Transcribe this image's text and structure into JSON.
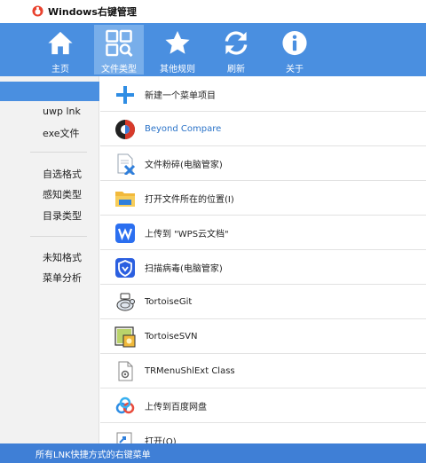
{
  "window": {
    "title": "Windows右键管理"
  },
  "toolbar": {
    "items": [
      {
        "label": "主页",
        "icon": "home-icon"
      },
      {
        "label": "文件类型",
        "icon": "file-types-icon",
        "active": true
      },
      {
        "label": "其他规则",
        "icon": "star-icon"
      },
      {
        "label": "刷新",
        "icon": "refresh-icon"
      },
      {
        "label": "关于",
        "icon": "info-icon"
      }
    ],
    "accent": "#4a8fe0"
  },
  "sidebar": {
    "items": [
      {
        "label": ""
      },
      {
        "label": "uwp lnk"
      },
      {
        "label": "exe文件"
      },
      {
        "label": "自选格式"
      },
      {
        "label": "感知类型"
      },
      {
        "label": "目录类型"
      },
      {
        "label": "未知格式"
      },
      {
        "label": "菜单分析"
      }
    ]
  },
  "menu_items": [
    {
      "label": "新建一个菜单项目",
      "icon": "plus-icon"
    },
    {
      "label": "Beyond Compare",
      "icon": "beyond-compare-icon",
      "highlight": true
    },
    {
      "label": "文件粉碎(电脑管家)",
      "icon": "file-shred-icon"
    },
    {
      "label": "打开文件所在的位置(I)",
      "icon": "folder-icon"
    },
    {
      "label": "上传到 \"WPS云文档\"",
      "icon": "wps-icon"
    },
    {
      "label": "扫描病毒(电脑管家)",
      "icon": "shield-icon"
    },
    {
      "label": "TortoiseGit",
      "icon": "tortoisegit-icon"
    },
    {
      "label": "TortoiseSVN",
      "icon": "tortoisesvn-icon"
    },
    {
      "label": "TRMenuShlExt Class",
      "icon": "document-gear-icon"
    },
    {
      "label": "上传到百度网盘",
      "icon": "baidu-cloud-icon"
    },
    {
      "label": "打开(O)",
      "icon": "shortcut-icon"
    }
  ],
  "statusbar": {
    "text": "所有LNK快捷方式的右键菜单"
  }
}
